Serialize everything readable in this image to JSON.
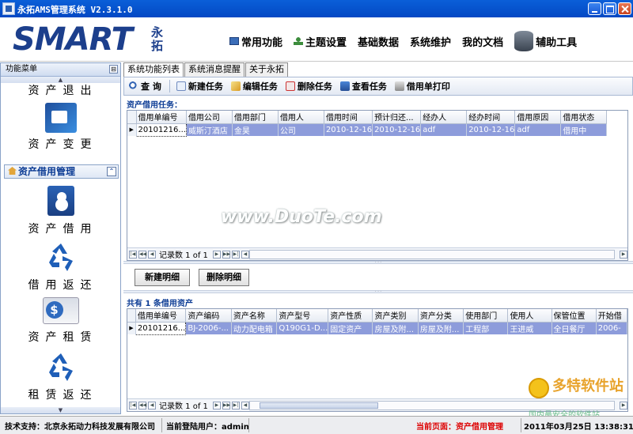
{
  "window": {
    "title": "永拓AMS管理系统 V2.3.1.0"
  },
  "header": {
    "logo_text": "SMART",
    "logo_cn": "永拓",
    "nav": [
      {
        "label": "常用功能",
        "icon": "monitor-icon"
      },
      {
        "label": "主题设置",
        "icon": "person-icon"
      },
      {
        "label": "基础数据"
      },
      {
        "label": "系统维护"
      },
      {
        "label": "我的文档"
      },
      {
        "label": "辅助工具",
        "icon": "database-icon"
      }
    ]
  },
  "sidebar": {
    "header": "功能菜单",
    "pin_glyph": "⊟",
    "items_top": [
      {
        "label": "资产退出"
      },
      {
        "label": "资产变更"
      }
    ],
    "section": {
      "label": "资产借用管理",
      "collapse_glyph": "⌃"
    },
    "items": [
      {
        "label": "资产借用"
      },
      {
        "label": "借用返还"
      },
      {
        "label": "资产租赁"
      },
      {
        "label": "租赁返还"
      }
    ]
  },
  "tabs": [
    {
      "label": "系统功能列表",
      "active": true
    },
    {
      "label": "系统消息提醒"
    },
    {
      "label": "关于永拓"
    }
  ],
  "toolbar": {
    "buttons": [
      {
        "label": "查 询",
        "icon": "search-icon"
      },
      {
        "label": "新建任务",
        "icon": "new-icon"
      },
      {
        "label": "编辑任务",
        "icon": "edit-icon"
      },
      {
        "label": "删除任务",
        "icon": "delete-icon"
      },
      {
        "label": "查看任务",
        "icon": "view-icon"
      },
      {
        "label": "借用单打印",
        "icon": "print-icon"
      }
    ]
  },
  "tasks": {
    "title": "资产借用任务：",
    "columns": [
      "借用单编号",
      "借用公司",
      "借用部门",
      "借用人",
      "借用时间",
      "预计归还...",
      "经办人",
      "经办时间",
      "借用原因",
      "借用状态"
    ],
    "rows": [
      [
        "20101216...",
        "威斯汀酒店",
        "金昊",
        "公司",
        "2010-12-16",
        "2010-12-16",
        "adf",
        "2010-12-16",
        "adf",
        "借用中"
      ]
    ],
    "pager": {
      "record_text": "记录数 1 of 1"
    }
  },
  "detail_buttons": {
    "new_label": "新建明细",
    "delete_label": "删除明细"
  },
  "assets": {
    "title": "共有 1 条借用资产",
    "columns": [
      "借用单编号",
      "资产编码",
      "资产名称",
      "资产型号",
      "资产性质",
      "资产类别",
      "资产分类",
      "使用部门",
      "使用人",
      "保管位置",
      "开始借"
    ],
    "rows": [
      [
        "20101216...",
        "BJ-2006-...",
        "动力配电箱",
        "Q190G1-D...",
        "固定资产",
        "房屋及附...",
        "房屋及附...",
        "工程部",
        "王进威",
        "全日餐厅",
        "2006-"
      ]
    ],
    "pager": {
      "record_text": "记录数 1 of 1"
    }
  },
  "statusbar": {
    "support": "技术支持：北京永拓动力科技发展有限公司",
    "user": "当前登陆用户：admin",
    "current_page": "当前页面：资产借用管理",
    "datetime": "2011年03月25日 13:38:31"
  },
  "watermark": {
    "main": "www.DuoTe.com",
    "site_logo": "多特软件站",
    "site_sub": "国内最安全的软件站"
  }
}
